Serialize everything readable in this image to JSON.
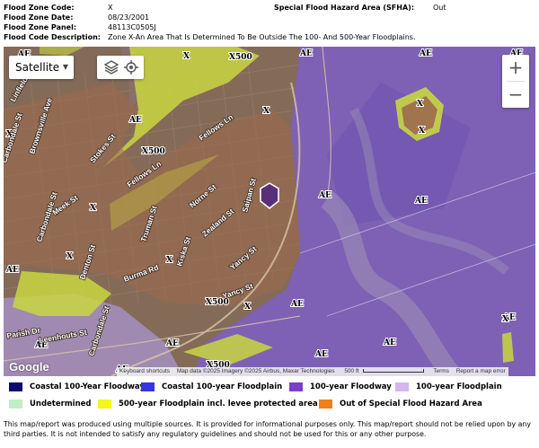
{
  "info": {
    "zone_code_label": "Flood Zone Code:",
    "zone_code": "X",
    "zone_date_label": "Flood Zone Date:",
    "zone_date": "08/23/2001",
    "zone_panel_label": "Flood Zone Panel:",
    "zone_panel": "48113C0505J",
    "zone_desc_label": "Flood Code Description:",
    "zone_desc": "Zone X-An Area That Is Determined To Be Outside The 100- And 500-Year Floodplains.",
    "sfha_label": "Special Flood Hazard Area (SFHA):",
    "sfha": "Out"
  },
  "map": {
    "map_type": "Satellite",
    "zoom_in": "+",
    "zoom_out": "−",
    "zone_labels": [
      "AE",
      "AE",
      "AE",
      "AE",
      "AE",
      "AE",
      "AE",
      "AE",
      "AE",
      "AE",
      "AE",
      "AE",
      "AE",
      "AE",
      "AE",
      "X",
      "X",
      "X",
      "X",
      "X",
      "X",
      "X",
      "X",
      "X",
      "X",
      "X500",
      "X500",
      "X500",
      "X500"
    ],
    "streets": [
      "Linfield Rd",
      "Brownsville Ave",
      "Stokes St",
      "Fellows Ln",
      "Fellows Ln",
      "Meek St",
      "Norne St",
      "Saipan St",
      "Zealand St",
      "Truman St",
      "Kiska St",
      "Carbondale St",
      "Carbondale St",
      "Denton St",
      "Burma Rd",
      "Yancy St",
      "Yancy St",
      "Parish Dr",
      "Carbondale St",
      "Leenhouts St"
    ],
    "colors": {
      "ae": "#7d5fc2",
      "x500": "#c9d641",
      "x": "#9c6a4d",
      "floodway": "#6b4aa3"
    },
    "attribution": {
      "shortcuts": "Keyboard shortcuts",
      "data": "Map data ©2025 Imagery ©2025 Airbus, Maxar Technologies",
      "scale": "500 ft",
      "terms": "Terms",
      "report": "Report a map error"
    },
    "logo": "Google"
  },
  "legend": [
    {
      "label": "Coastal 100-Year Floodway",
      "color": "#0a0a73"
    },
    {
      "label": "Coastal 100-year Floodplain",
      "color": "#3535e6"
    },
    {
      "label": "100-year Floodway",
      "color": "#7a3fc9"
    },
    {
      "label": "100-year Floodplain",
      "color": "#d3b5f0"
    },
    {
      "label": "Undetermined",
      "color": "#bfefc3"
    },
    {
      "label": "500-year Floodplain incl. levee protected area",
      "color": "#f5f51f"
    },
    {
      "label": "Out of Special Flood Hazard Area",
      "color": "#f27f17"
    }
  ],
  "disclaimer": "This map/report was produced using multiple sources. It is provided for informational purposes only. This map/report should not be relied upon by any third parties. It is not intended to satisfy any regulatory guidelines and should not be used for this or any other purpose."
}
